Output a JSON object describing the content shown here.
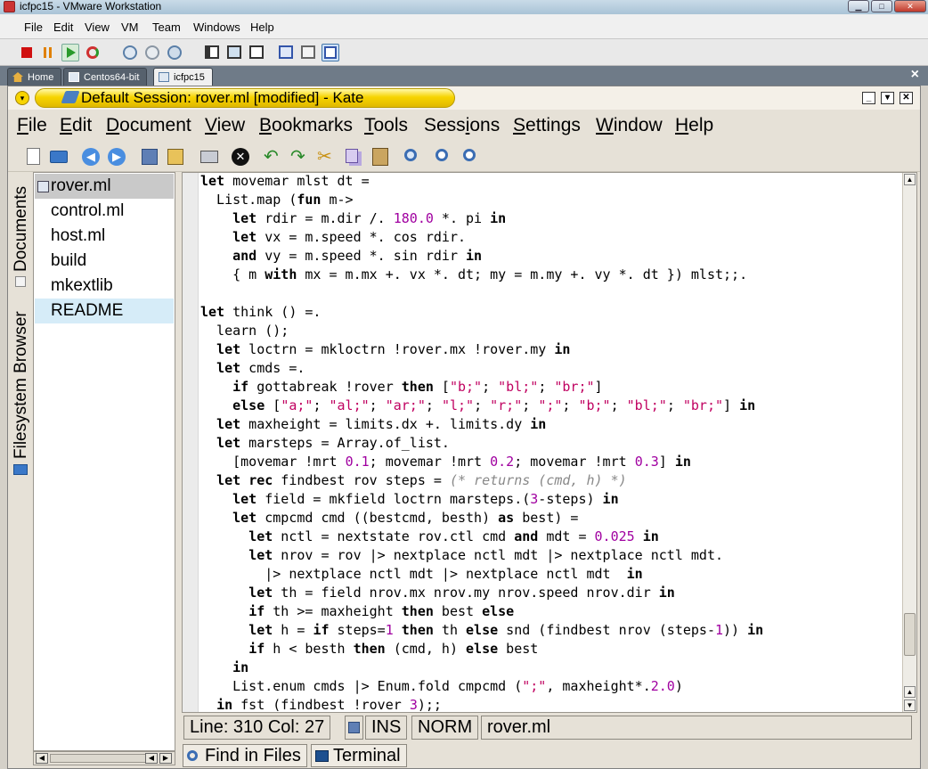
{
  "vmware": {
    "title": "icfpc15 - VMware Workstation",
    "menu": [
      "File",
      "Edit",
      "View",
      "VM",
      "Team",
      "Windows",
      "Help"
    ],
    "tabs": [
      "Home",
      "Centos64-bit",
      "icfpc15"
    ],
    "tabs_close": "×"
  },
  "kate": {
    "title": "Default Session: rover.ml [modified] - Kate",
    "menu": [
      {
        "u": "F",
        "rest": "ile"
      },
      {
        "u": "E",
        "rest": "dit"
      },
      {
        "u": "D",
        "rest": "ocument"
      },
      {
        "u": "V",
        "rest": "iew"
      },
      {
        "u": "B",
        "rest": "ookmarks"
      },
      {
        "u": "T",
        "rest": "ools"
      },
      {
        "pre": "Sess",
        "u": "i",
        "rest": "ons"
      },
      {
        "u": "S",
        "rest": "ettings"
      },
      {
        "u": "W",
        "rest": "indow"
      },
      {
        "u": "H",
        "rest": "elp"
      }
    ],
    "side_tabs": [
      "Documents",
      "Filesystem Browser"
    ],
    "files": [
      "rover.ml",
      "control.ml",
      "host.ml",
      "build",
      "mkextlib",
      "README"
    ],
    "status": {
      "position": "Line: 310 Col: 27",
      "mode": "INS",
      "input_mode": "NORM",
      "filename": "rover.ml"
    },
    "bottom_tabs": [
      "Find in Files",
      "Terminal"
    ]
  },
  "code": {
    "lines": [
      "let movemar mlst dt =",
      "  List.map (fun m->",
      "    let rdir = m.dir /. 180.0 *. pi in",
      "    let vx = m.speed *. cos rdir.",
      "    and vy = m.speed *. sin rdir in",
      "    { m with mx = m.mx +. vx *. dt; my = m.my +. vy *. dt }) mlst;;.",
      "",
      "let think () =.",
      "  learn ();",
      "  let loctrn = mkloctrn !rover.mx !rover.my in",
      "  let cmds =.",
      "    if gottabreak !rover then [\"b;\"; \"bl;\"; \"br;\"]",
      "    else [\"a;\"; \"al;\"; \"ar;\"; \"l;\"; \"r;\"; \";\"; \"b;\"; \"bl;\"; \"br;\"] in",
      "  let maxheight = limits.dx +. limits.dy in",
      "  let marsteps = Array.of_list.",
      "    [movemar !mrt 0.1; movemar !mrt 0.2; movemar !mrt 0.3] in",
      "  let rec findbest rov steps = (* returns (cmd, h) *)",
      "    let field = mkfield loctrn marsteps.(3-steps) in",
      "    let cmpcmd cmd ((bestcmd, besth) as best) =",
      "      let nctl = nextstate rov.ctl cmd and mdt = 0.025 in",
      "      let nrov = rov |> nextplace nctl mdt |> nextplace nctl mdt.",
      "        |> nextplace nctl mdt |> nextplace nctl mdt  in",
      "      let th = field nrov.mx nrov.my nrov.speed nrov.dir in",
      "      if th >= maxheight then best else",
      "      let h = if steps=1 then th else snd (findbest nrov (steps-1)) in",
      "      if h < besth then (cmd, h) else best",
      "    in",
      "    List.enum cmds |> Enum.fold cmpcmd (\";\", maxheight*.2.0)",
      "  in fst (findbest !rover 3);;"
    ]
  },
  "colors": {
    "kate_title_yellow": "#f7d400",
    "selected_file": "#c9c9c9",
    "highlight_file": "#d6ecf8",
    "string": "#c00060",
    "number": "#a000a0",
    "comment": "#888888"
  }
}
